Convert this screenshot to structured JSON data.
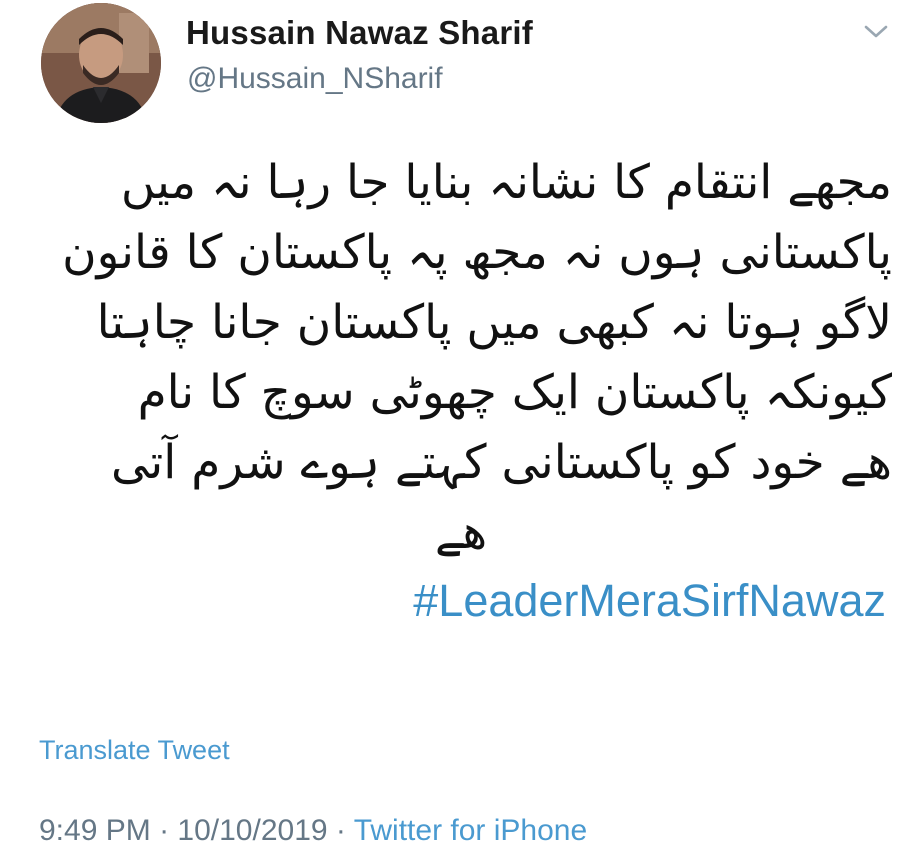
{
  "tweet": {
    "author": {
      "display_name": "Hussain Nawaz Sharif",
      "handle": "@Hussain_NSharif",
      "avatar_icon": "profile-photo"
    },
    "menu_icon": "chevron-down-icon",
    "text_lines": [
      "مجھے انتقام کا نشانہ بنایا جا رہا نہ میں",
      "پاکستانی ہوں نہ مجھ پہ پاکستان کا قانون",
      "لاگو ہوتا نہ کبھی میں پاکستان جانا چاہتا",
      "کیونکہ پاکستان ایک چھوٹی سوچ کا نام",
      "ھے خود کو پاکستانی کہتے ہوے شرم آتی",
      "ھے"
    ],
    "hashtag": "#LeaderMeraSirfNawaz",
    "translate_label": "Translate Tweet",
    "time": "9:49 PM",
    "separator": "·",
    "date": "10/10/2019",
    "source": "Twitter for iPhone"
  },
  "colors": {
    "link": "#3a8fc7",
    "muted": "#657786",
    "text": "#14171a"
  }
}
